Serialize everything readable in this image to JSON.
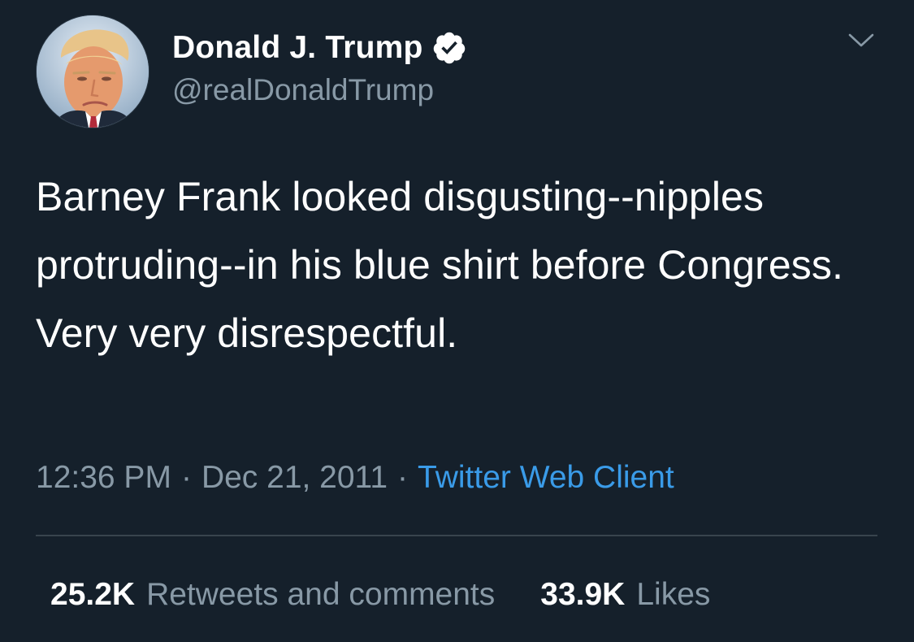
{
  "author": {
    "display_name": "Donald J. Trump",
    "handle": "@realDonaldTrump",
    "verified": true,
    "avatar_icon": "profile-photo"
  },
  "tweet": {
    "text": "Barney Frank looked disgusting--nipples protruding--in his blue shirt before Congress. Very very disrespectful.",
    "time": "12:36 PM",
    "separator": "·",
    "date": "Dec 21, 2011",
    "source": "Twitter Web Client"
  },
  "stats": {
    "retweets_count": "25.2K",
    "retweets_label": "Retweets and comments",
    "likes_count": "33.9K",
    "likes_label": "Likes"
  },
  "colors": {
    "background": "#15202b",
    "text": "#ffffff",
    "secondary_text": "#8899a6",
    "link": "#3a9be8",
    "divider": "#38444d"
  },
  "icons": {
    "verified": "verified-badge-icon",
    "menu": "chevron-down-icon"
  }
}
